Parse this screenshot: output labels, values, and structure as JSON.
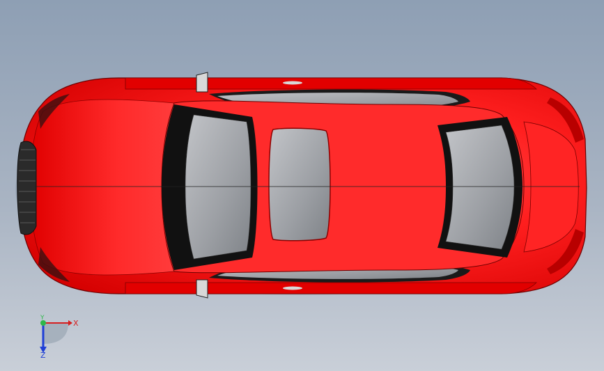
{
  "scene": {
    "model": "car-top-view",
    "view": "top",
    "body_color": "#ff1a1a",
    "glass_color": "#9ea1a6",
    "background_top": "#8e9fb4",
    "background_bottom": "#c9cfd8"
  },
  "triad": {
    "x_label": "X",
    "y_label": "Y",
    "z_label": "Z",
    "x_color": "#d61f1f",
    "y_color": "#2fb84a",
    "z_color": "#1f3fd6"
  }
}
